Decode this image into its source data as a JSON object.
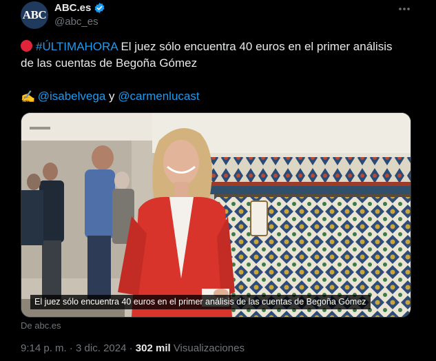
{
  "author": {
    "avatar_text": "ABC",
    "display_name": "ABC.es",
    "handle": "@abc_es",
    "verified_icon": "verified-badge-icon"
  },
  "more_icon": "more-options-icon",
  "tweet": {
    "hashtag": "#ÚLTIMAHORA",
    "line1_rest": " El juez sólo encuentra 40 euros en el primer análisis",
    "line2": "de las cuentas de Begoña Gómez",
    "mention1": "@isabelvega",
    "conjunction": " y ",
    "mention2": "@carmenlucast"
  },
  "media": {
    "caption": "El juez sólo encuentra 40 euros en el primer análisis de las cuentas de Begoña Gómez"
  },
  "source": "De abc.es",
  "meta": {
    "time": "9:14 p. m.",
    "separator": " · ",
    "date": "3 dic. 2024",
    "dot": " · ",
    "views_count": "302 mil",
    "views_label": " Visualizaciones"
  },
  "colors": {
    "background": "#000000",
    "text": "#e7e9ea",
    "muted": "#71767b",
    "link": "#1d9bf0",
    "jacket": "#d8342b"
  }
}
